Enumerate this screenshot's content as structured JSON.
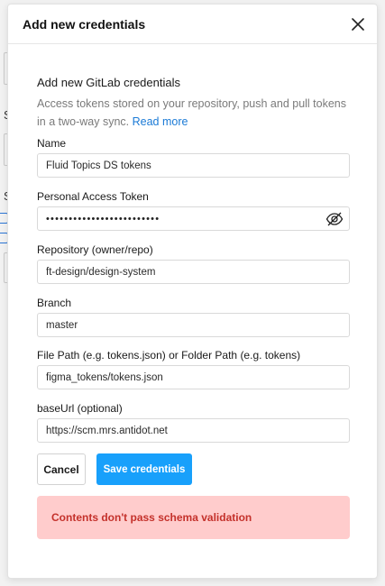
{
  "background": {
    "fragment_1": "S",
    "fragment_2": "S"
  },
  "modal": {
    "title": "Add new credentials",
    "close_icon": "close-icon"
  },
  "form": {
    "section_title": "Add new GitLab credentials",
    "description": "Access tokens stored on your repository, push and pull tokens in a two-way sync.",
    "read_more": "Read more",
    "name_label": "Name",
    "name_value": "Fluid Topics DS tokens",
    "token_label": "Personal Access Token",
    "token_value": "•••••••••••••••••••••••••",
    "token_icon": "eye-off-icon",
    "repo_label": "Repository (owner/repo)",
    "repo_value": "ft-design/design-system",
    "branch_label": "Branch",
    "branch_value": "master",
    "path_label": "File Path (e.g. tokens.json) or Folder Path (e.g. tokens)",
    "path_value": "figma_tokens/tokens.json",
    "baseurl_label": "baseUrl (optional)",
    "baseurl_value": "https://scm.mrs.antidot.net"
  },
  "actions": {
    "cancel_label": "Cancel",
    "save_label": "Save credentials"
  },
  "error": {
    "message": "Contents don't pass schema validation"
  },
  "colors": {
    "primary": "#18a0fb",
    "error_bg": "#ffcccc",
    "error_text": "#c4312b",
    "link": "#1a7ad6"
  }
}
